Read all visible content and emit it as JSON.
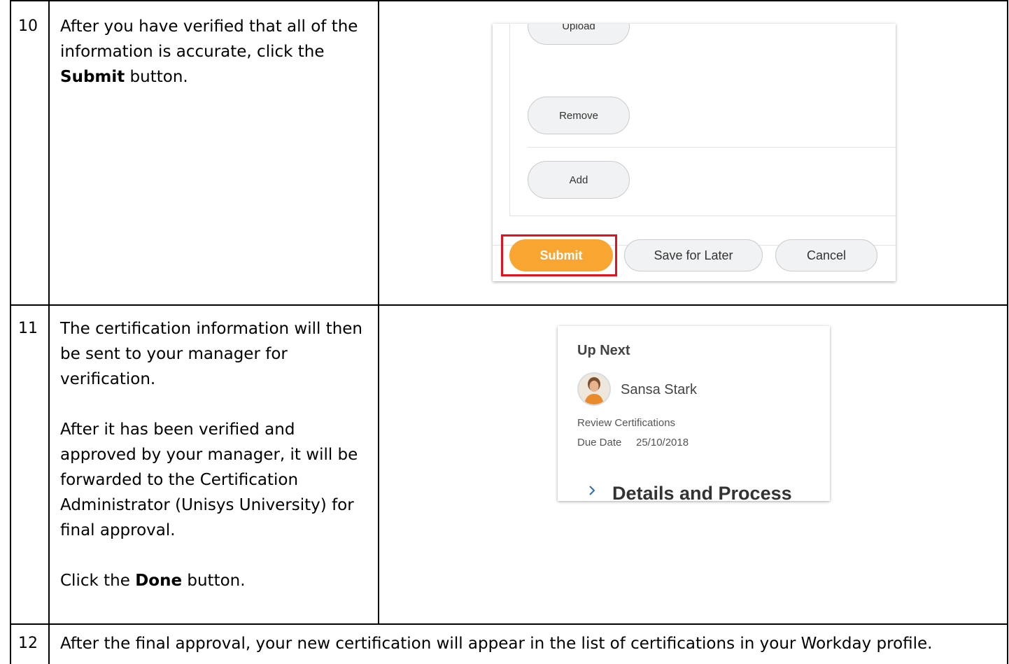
{
  "steps": [
    {
      "number": "10",
      "text_before": "After you have verified that all of the information is accurate, click the ",
      "bold": "Submit",
      "text_after": " button."
    },
    {
      "number": "11",
      "paragraph1": "The certification information will then be sent to your manager for verification.",
      "paragraph2": "After it has been verified and approved by your manager, it will be forwarded to the Certification Administrator (Unisys University) for final approval.",
      "paragraph3_before": "Click the ",
      "paragraph3_bold": "Done",
      "paragraph3_after": " button."
    },
    {
      "number": "12",
      "text": "After the final approval, your new certification will appear in the list of certifications in your Workday profile."
    }
  ],
  "form_screenshot": {
    "upload_label": "Upload",
    "remove_label": "Remove",
    "add_label": "Add",
    "submit_label": "Submit",
    "save_later_label": "Save for Later",
    "cancel_label": "Cancel",
    "accent_color": "#f8a631",
    "highlight_color": "#e3111c"
  },
  "up_next_card": {
    "heading": "Up Next",
    "person_name": "Sansa Stark",
    "task": "Review Certifications",
    "due_label": "Due Date",
    "due_value": "25/10/2018",
    "section_title": "Details and Process",
    "avatar_icon": "person-avatar-icon",
    "chevron_icon": "chevron-right-icon"
  }
}
